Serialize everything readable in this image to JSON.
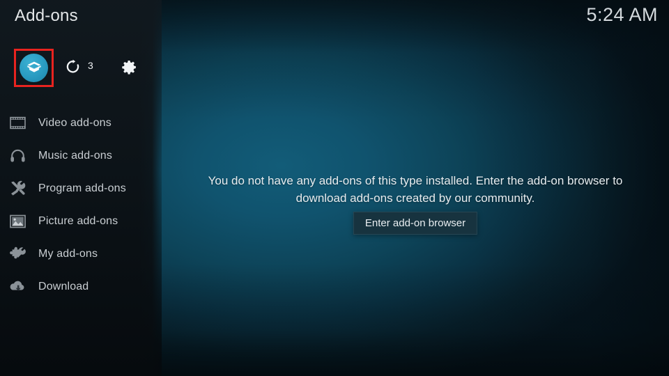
{
  "header": {
    "title": "Add-ons",
    "clock": "5:24 AM"
  },
  "toolbar": {
    "addon_box": {
      "name": "addon-box-button",
      "icon": "box-icon",
      "highlighted": true,
      "highlight_color": "#e8231f",
      "accent_color": "#2a9cc2"
    },
    "refresh": {
      "name": "refresh-button",
      "icon": "refresh-icon"
    },
    "update_count": "3",
    "settings": {
      "name": "settings-button",
      "icon": "gear-icon"
    }
  },
  "sidebar": {
    "items": [
      {
        "label": "Video add-ons",
        "icon": "film-strip-icon"
      },
      {
        "label": "Music add-ons",
        "icon": "headphones-icon"
      },
      {
        "label": "Program add-ons",
        "icon": "program-tools-icon"
      },
      {
        "label": "Picture add-ons",
        "icon": "picture-frame-icon"
      },
      {
        "label": "My add-ons",
        "icon": "puzzle-wrench-icon"
      },
      {
        "label": "Download",
        "icon": "cloud-download-icon"
      }
    ]
  },
  "main": {
    "empty_message": "You do not have any add-ons of this type installed. Enter the add-on browser to download add-ons created by our community.",
    "browser_button_label": "Enter add-on browser"
  },
  "colors": {
    "background_teal": "#10536e",
    "sidebar": "#0d1419",
    "accent": "#2a9cc2",
    "highlight": "#e8231f",
    "button_bg": "#17333f",
    "text": "#e7ecef"
  }
}
